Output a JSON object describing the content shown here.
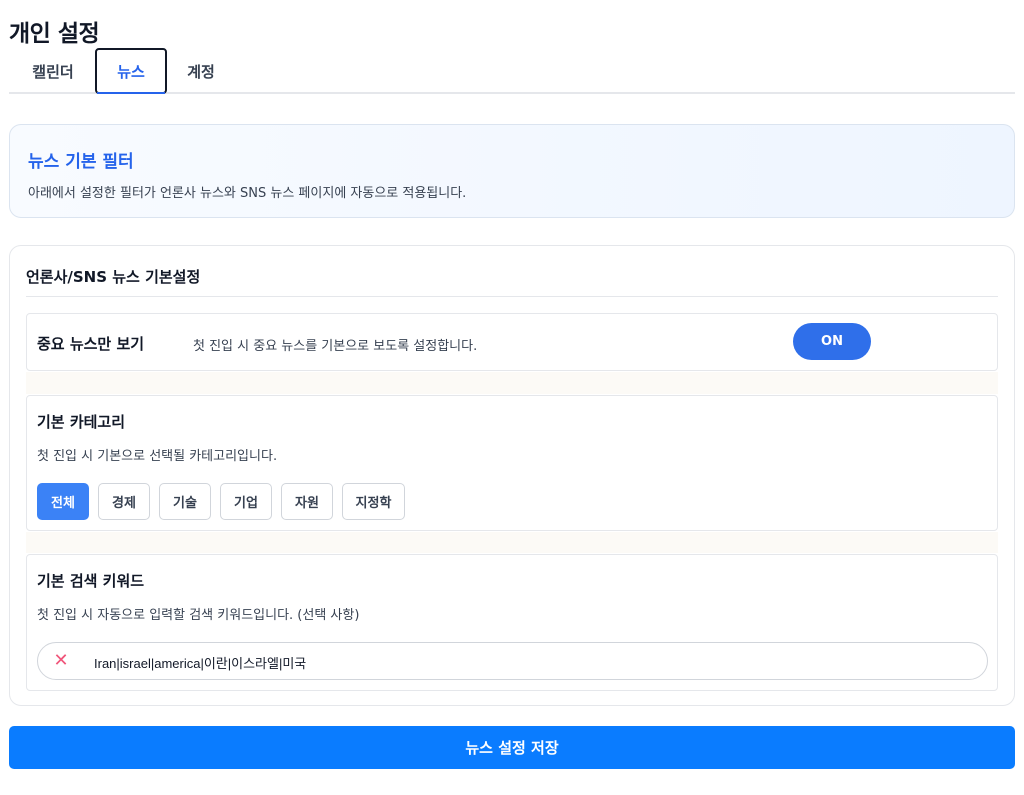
{
  "page": {
    "title": "개인 설정"
  },
  "tabs": [
    {
      "label": "캘린더"
    },
    {
      "label": "뉴스"
    },
    {
      "label": "계정"
    }
  ],
  "banner": {
    "title": "뉴스 기본 필터",
    "description": "아래에서 설정한 필터가 언론사 뉴스와 SNS 뉴스 페이지에 자동으로 적용됩니다."
  },
  "settings": {
    "title": "언론사/SNS 뉴스 기본설정",
    "important_only": {
      "label": "중요 뉴스만 보기",
      "description": "첫 진입 시 중요 뉴스를 기본으로 보도록 설정합니다.",
      "toggle_label": "ON"
    },
    "category": {
      "title": "기본 카테고리",
      "description": "첫 진입 시 기본으로 선택될 카테고리입니다.",
      "options": [
        "전체",
        "경제",
        "기술",
        "기업",
        "자원",
        "지정학"
      ],
      "selected": "전체"
    },
    "keyword": {
      "title": "기본 검색 키워드",
      "description": "첫 진입 시 자동으로 입력할 검색 키워드입니다. (선택 사항)",
      "value": "Iran|israel|america|이란|이스라엘|미국",
      "clear_icon": "close-icon"
    }
  },
  "save_button": {
    "label": "뉴스 설정 저장"
  },
  "colors": {
    "primary": "#0a7cff",
    "accent_blue": "#2563eb",
    "toggle_on": "#2f6fea",
    "chip_active": "#3b82f6",
    "clear_icon": "#f0557a"
  }
}
